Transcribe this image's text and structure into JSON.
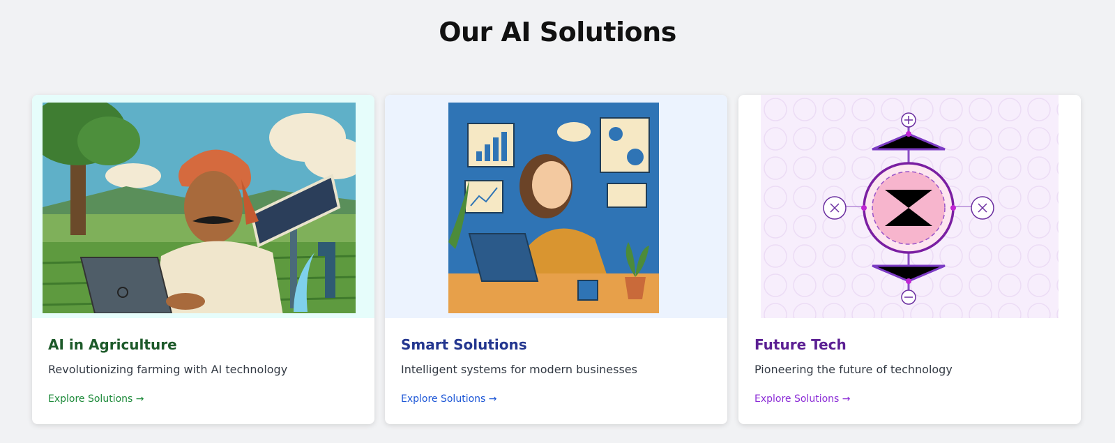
{
  "page": {
    "title": "Our AI Solutions"
  },
  "cards": [
    {
      "title": "AI in Agriculture",
      "description": "Revolutionizing farming with AI technology",
      "link_label": "Explore Solutions →",
      "image": "farmer-with-laptop-and-solar-panel-illustration",
      "accent": "#1d5a2a",
      "link_color": "#1d8a3a",
      "media_bg": "#e6fdfb"
    },
    {
      "title": "Smart Solutions",
      "description": "Intelligent systems for modern businesses",
      "link_label": "Explore Solutions →",
      "image": "businesswoman-with-laptop-and-charts-illustration",
      "accent": "#23368f",
      "link_color": "#1c56d6",
      "media_bg": "#ecf3fe"
    },
    {
      "title": "Future Tech",
      "description": "Pioneering the future of technology",
      "link_label": "Explore Solutions →",
      "image": "abstract-circuit-hourglass-diagram",
      "accent": "#5b1f93",
      "link_color": "#8b2cd6",
      "media_bg": "#f6effb"
    }
  ]
}
